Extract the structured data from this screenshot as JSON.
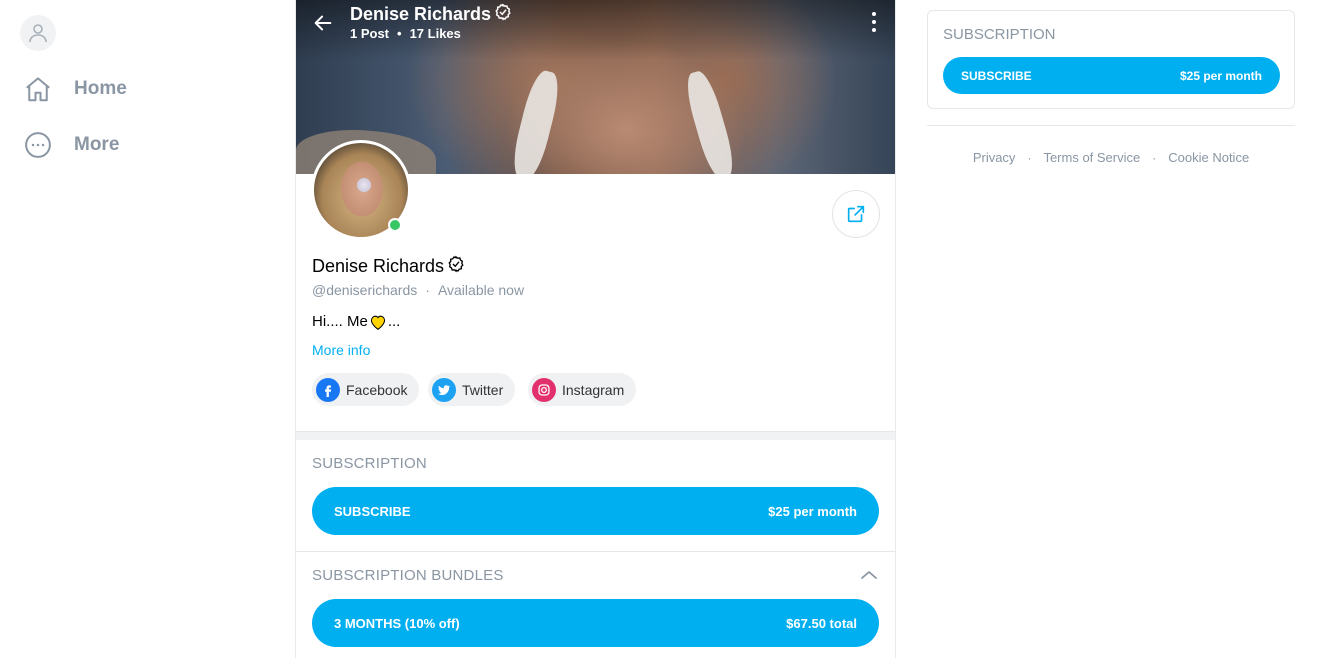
{
  "nav": {
    "items": [
      {
        "label": "Home",
        "icon": "home-icon"
      },
      {
        "label": "More",
        "icon": "more-icon"
      }
    ]
  },
  "cover": {
    "name": "Denise Richards",
    "posts": "1 Post",
    "likes": "17 Likes",
    "separator": "•"
  },
  "profile": {
    "name": "Denise Richards",
    "handle": "@deniserichards",
    "status": "Available now",
    "separator": "·",
    "bio_prefix": "Hi.... Me",
    "bio_suffix": "...",
    "more_info": "More info",
    "online": true
  },
  "socials": [
    {
      "label": "Facebook",
      "icon": "facebook-icon",
      "color": "#1877f2"
    },
    {
      "label": "Twitter",
      "icon": "twitter-icon",
      "color": "#1da1f2"
    },
    {
      "label": "Instagram",
      "icon": "instagram-icon",
      "color": "#e1306c"
    }
  ],
  "subscription": {
    "title": "SUBSCRIPTION",
    "button_label": "SUBSCRIBE",
    "price": "$25 per month"
  },
  "bundles": {
    "title": "SUBSCRIPTION BUNDLES",
    "items": [
      {
        "label": "3 MONTHS (10% off)",
        "price": "$67.50 total"
      }
    ]
  },
  "sidebar_right": {
    "title": "SUBSCRIPTION",
    "button_label": "SUBSCRIBE",
    "price": "$25 per month"
  },
  "footer": {
    "links": [
      "Privacy",
      "Terms of Service",
      "Cookie Notice"
    ],
    "separator": "·"
  },
  "colors": {
    "accent": "#00aff0",
    "muted": "#8a96a3",
    "online": "#37c765"
  }
}
